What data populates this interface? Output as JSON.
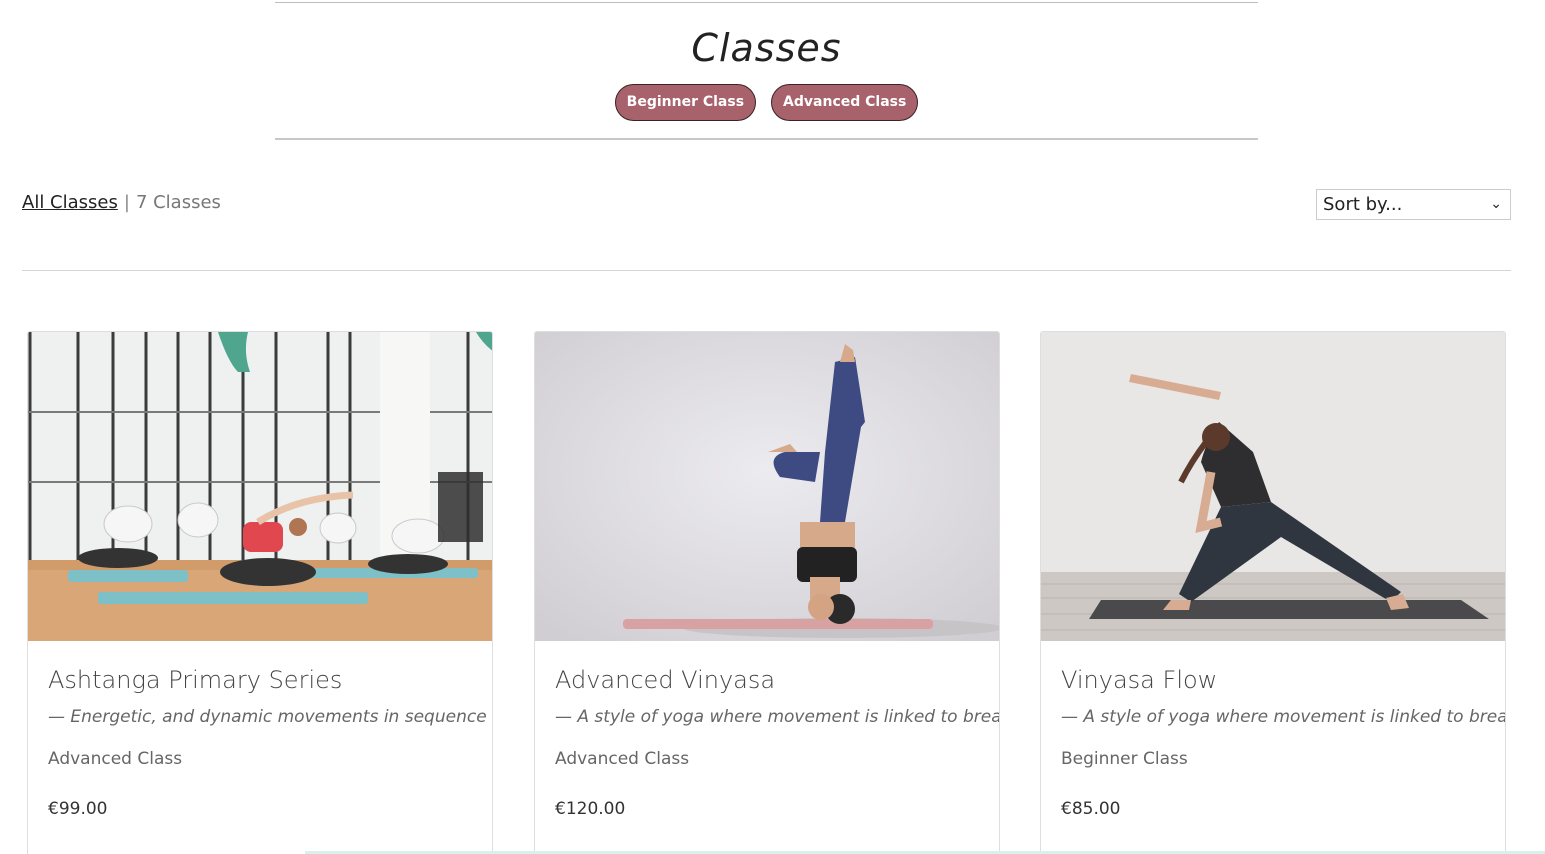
{
  "hero": {
    "title": "Classes",
    "categories": [
      {
        "label": "Beginner Class"
      },
      {
        "label": "Advanced Class"
      }
    ]
  },
  "toolbar": {
    "breadcrumb_link": "All Classes",
    "separator": "|",
    "count_text": "7 Classes",
    "sort_selected": "Sort by..."
  },
  "colors": {
    "category_button": "#a8626b",
    "accent_line": "#d8f1ef"
  },
  "cards": [
    {
      "title": "Ashtanga Primary Series",
      "description": "— Energetic, and dynamic movements in sequence",
      "category": "Advanced Class",
      "price": "€99.00",
      "image": "group yoga class side stretch photo"
    },
    {
      "title": "Advanced Vinyasa",
      "description": "— A style of yoga where movement is linked to breath",
      "category": "Advanced Class",
      "price": "€120.00",
      "image": "headstand yoga pose photo"
    },
    {
      "title": "Vinyasa Flow",
      "description": "— A style of yoga where movement is linked to breath",
      "category": "Beginner Class",
      "price": "€85.00",
      "image": "extended side angle pose photo"
    }
  ]
}
